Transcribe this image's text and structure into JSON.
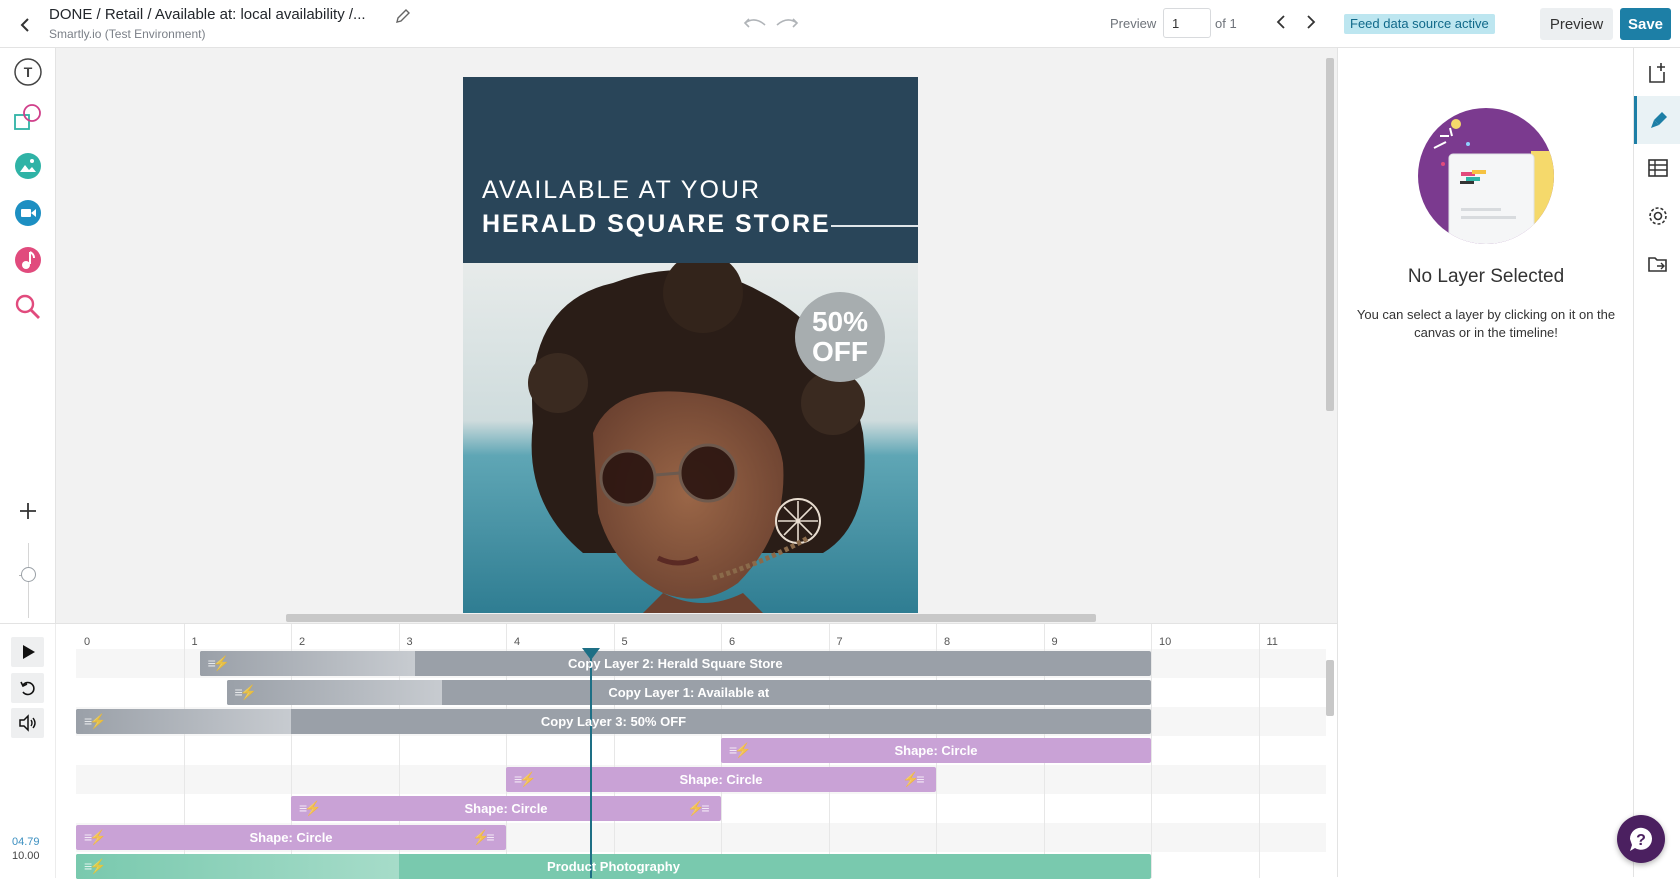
{
  "header": {
    "title": "DONE / Retail / Available at: local availability /...",
    "subtitle": "Smartly.io (Test Environment)",
    "preview_label": "Preview",
    "page_value": "1",
    "page_of": "of 1",
    "feed_badge": "Feed data source active",
    "preview_button": "Preview",
    "save_button": "Save"
  },
  "left_tools": [
    "text-tool-icon",
    "shape-tool-icon",
    "image-tool-icon",
    "video-tool-icon",
    "audio-tool-icon",
    "search-icon"
  ],
  "poster": {
    "headline_line1": "AVAILABLE AT YOUR",
    "headline_line2": "HERALD SQUARE STORE",
    "sale_line1": "50%",
    "sale_line2": "OFF"
  },
  "right_panel": {
    "title": "No Layer Selected",
    "hint": "You can select a layer by clicking on it on the canvas or in the timeline!"
  },
  "timeline": {
    "current_time": "04.79",
    "total_time": "10.00",
    "playhead_seconds": 4.79,
    "ticks": [
      "0",
      "1",
      "2",
      "3",
      "4",
      "5",
      "6",
      "7",
      "8",
      "9",
      "10",
      "11"
    ],
    "layers": [
      {
        "label": "Copy Layer 2: Herald Square Store",
        "start": 1.15,
        "fade_end": 3.15,
        "end": 10,
        "color": "gray"
      },
      {
        "label": "Copy Layer 1: Available at",
        "start": 1.4,
        "fade_end": 3.4,
        "end": 10,
        "color": "gray"
      },
      {
        "label": "Copy Layer 3: 50% OFF",
        "start": 0,
        "fade_end": 2,
        "end": 10,
        "color": "gray"
      },
      {
        "label": "Shape: Circle",
        "start": 6,
        "fade_end": 6,
        "end": 10,
        "color": "purple"
      },
      {
        "label": "Shape: Circle",
        "start": 4,
        "fade_end": 4,
        "end": 8,
        "color": "purple"
      },
      {
        "label": "Shape: Circle",
        "start": 2,
        "fade_end": 2,
        "end": 6,
        "color": "purple"
      },
      {
        "label": "Shape: Circle",
        "start": 0,
        "fade_end": 0,
        "end": 4,
        "color": "purple"
      },
      {
        "label": "Product Photography",
        "start": 0,
        "fade_end": 3,
        "end": 10,
        "color": "teal"
      }
    ]
  },
  "colors": {
    "accent": "#1d7fa6",
    "gray_bar": "#9aa0a8",
    "purple_bar": "#c9a2d6",
    "teal_bar": "#79c9ae",
    "poster_navy": "#294559"
  }
}
